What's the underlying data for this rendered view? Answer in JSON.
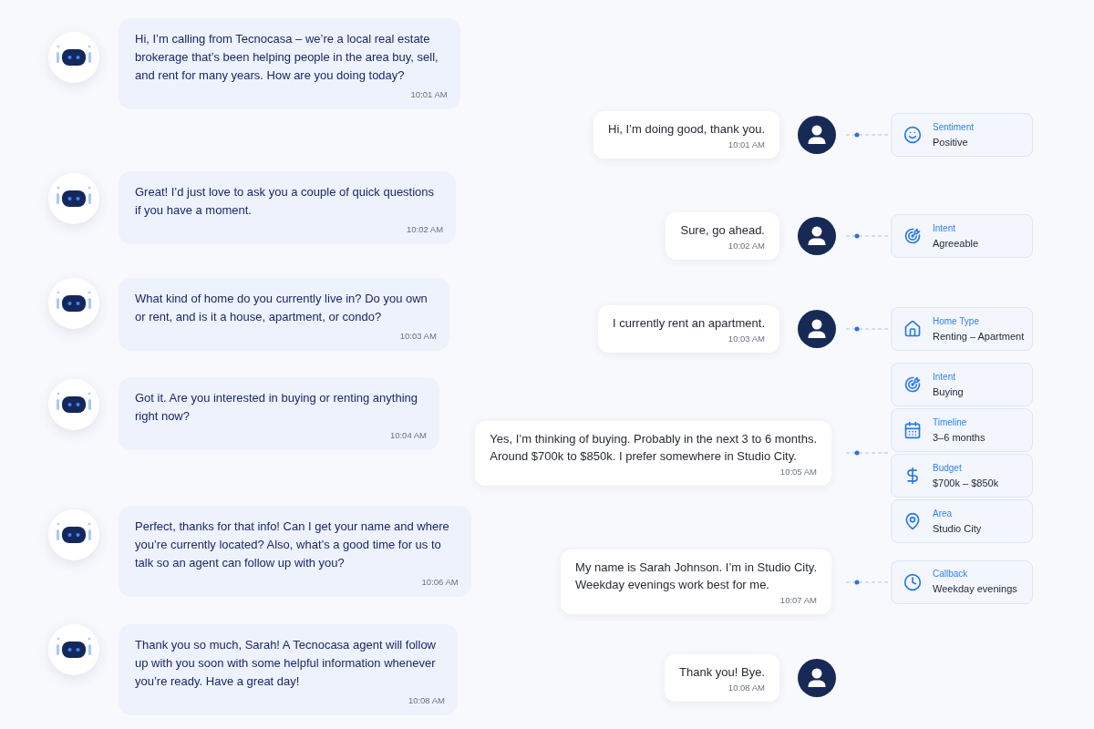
{
  "agent_messages": [
    {
      "lines": [
        "Hi, I’m calling from Tecnocasa – we’re a local real estate",
        "brokerage that’s been helping people in the area buy, sell,",
        "and rent for many years. How are you doing today?"
      ],
      "time": "10:01 AM"
    },
    {
      "lines": [
        "Great! I’d just love to ask you a couple of quick questions",
        "if you have a moment."
      ],
      "time": "10:02 AM"
    },
    {
      "lines": [
        "What kind of home do you currently live in? Do you own",
        "or rent, and is it a house, apartment, or condo?"
      ],
      "time": "10:03 AM"
    },
    {
      "lines": [
        "Got it. Are you interested in buying or renting anything",
        "right now?"
      ],
      "time": "10:04 AM"
    },
    {
      "lines": [
        "Perfect, thanks for that info! Can I get your name and where",
        "you’re currently located? Also, what’s a good time for us to",
        "talk so an agent can follow up with you?"
      ],
      "time": "10:06 AM"
    },
    {
      "lines": [
        "Thank you so much, Sarah! A Tecnocasa agent will follow",
        "up with you soon with some helpful information whenever",
        "you’re ready. Have a great day!"
      ],
      "time": "10:08 AM"
    }
  ],
  "caller_messages": [
    {
      "lines": [
        "Hi, I’m doing good, thank you."
      ],
      "time": "10:01 AM",
      "avatar": true,
      "insights": [
        {
          "kind": "sentiment",
          "label": "Sentiment",
          "value": "Positive"
        }
      ]
    },
    {
      "lines": [
        "Sure, go ahead."
      ],
      "time": "10:02 AM",
      "avatar": true,
      "insights": [
        {
          "kind": "intent",
          "label": "Intent",
          "value": "Agreeable"
        }
      ]
    },
    {
      "lines": [
        "I currently rent an apartment."
      ],
      "time": "10:03 AM",
      "avatar": true,
      "insights": [
        {
          "kind": "home_type",
          "label": "Home Type",
          "value": "Renting – Apartment"
        }
      ]
    },
    {
      "lines": [
        "Yes, I’m thinking of buying. Probably in the next 3 to 6 months.",
        "Around $700k to $850k. I prefer somewhere in Studio City."
      ],
      "time": "10:05 AM",
      "avatar": false,
      "insights": [
        {
          "kind": "intent",
          "label": "Intent",
          "value": "Buying"
        },
        {
          "kind": "timeline",
          "label": "Timeline",
          "value": "3–6 months"
        },
        {
          "kind": "budget",
          "label": "Budget",
          "value": "$700k – $850k"
        },
        {
          "kind": "area",
          "label": "Area",
          "value": "Studio City"
        }
      ]
    },
    {
      "lines": [
        "My name is Sarah Johnson. I’m in Studio City.",
        "Weekday evenings work best for me."
      ],
      "time": "10:07 AM",
      "avatar": false,
      "insights": [
        {
          "kind": "callback",
          "label": "Callback",
          "value": "Weekday evenings"
        }
      ]
    },
    {
      "lines": [
        "Thank you! Bye."
      ],
      "time": "10:08 AM",
      "avatar": true
    }
  ]
}
